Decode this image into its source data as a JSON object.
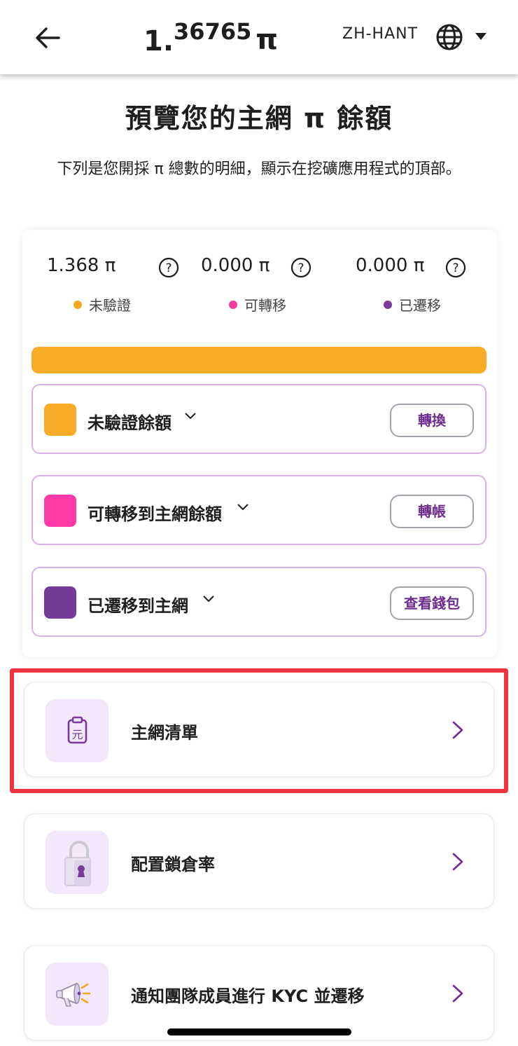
{
  "header": {
    "balance_integer": "1.",
    "balance_decimal": "36765",
    "balance_symbol": "π",
    "language": "ZH-HANT"
  },
  "page": {
    "title": "預覽您的主網 π 餘額",
    "subtitle": "下列是您開採 π 總數的明細，顯示在挖礦應用程式的頂部。"
  },
  "stats": [
    {
      "value": "1.368 π",
      "legend": "未驗證",
      "color": "#f5a623"
    },
    {
      "value": "0.000 π",
      "legend": "可轉移",
      "color": "#f53ba3"
    },
    {
      "value": "0.000 π",
      "legend": "已遷移",
      "color": "#7a3a9a"
    }
  ],
  "progress": {
    "unverified_fraction": 1.0,
    "color": "#f8ab27"
  },
  "balance_rows": [
    {
      "label": "未驗證餘額",
      "button": "轉換",
      "color": "#f8ab27"
    },
    {
      "label": "可轉移到主網餘額",
      "button": "轉帳",
      "color": "#ff3aa8"
    },
    {
      "label": "已遷移到主網",
      "button": "查看錢包",
      "color": "#763a98"
    }
  ],
  "menu": [
    {
      "label": "主網清單",
      "icon": "clipboard-yuan-icon"
    },
    {
      "label": "配置鎖倉率",
      "icon": "padlock-icon"
    },
    {
      "label": "通知團隊成員進行 KYC 並遷移",
      "icon": "megaphone-icon"
    }
  ],
  "colors": {
    "accent_purple": "#6d2c8f",
    "row_border": "#d6b3e6",
    "highlight": "#f0333e"
  }
}
